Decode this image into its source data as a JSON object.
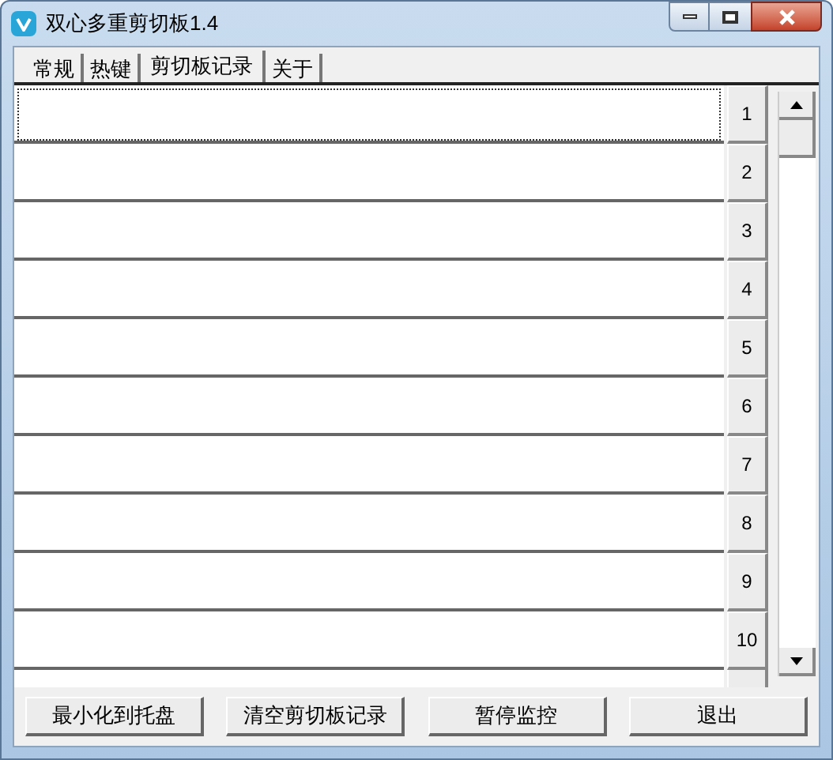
{
  "window": {
    "title": "双心多重剪切板1.4"
  },
  "tabs": [
    {
      "label": "常规",
      "selected": false
    },
    {
      "label": "热键",
      "selected": false
    },
    {
      "label": "剪切板记录",
      "selected": true
    },
    {
      "label": "关于",
      "selected": false
    }
  ],
  "slots": [
    {
      "label": "1",
      "focused": true
    },
    {
      "label": "2",
      "focused": false
    },
    {
      "label": "3",
      "focused": false
    },
    {
      "label": "4",
      "focused": false
    },
    {
      "label": "5",
      "focused": false
    },
    {
      "label": "6",
      "focused": false
    },
    {
      "label": "7",
      "focused": false
    },
    {
      "label": "8",
      "focused": false
    },
    {
      "label": "9",
      "focused": false
    },
    {
      "label": "10",
      "focused": false
    }
  ],
  "buttons": [
    "最小化到托盘",
    "清空剪切板记录",
    "暂停监控",
    "退出"
  ]
}
